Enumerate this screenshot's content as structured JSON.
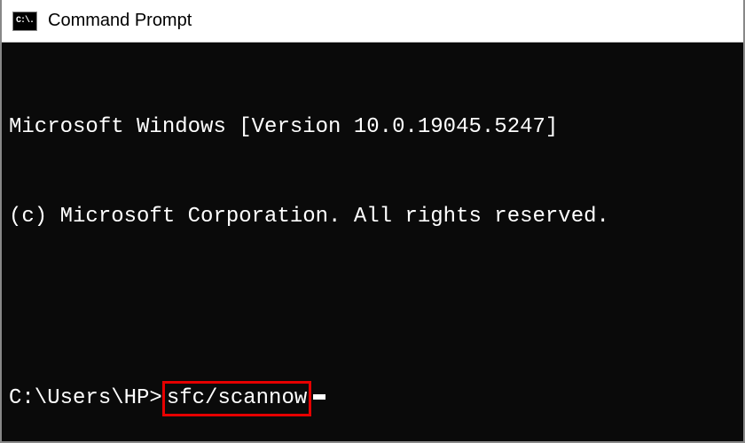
{
  "titlebar": {
    "icon_text": "C:\\.",
    "title": "Command Prompt"
  },
  "terminal": {
    "line1": "Microsoft Windows [Version 10.0.19045.5247]",
    "line2": "(c) Microsoft Corporation. All rights reserved.",
    "prompt": "C:\\Users\\HP>",
    "command": "sfc/scannow"
  }
}
